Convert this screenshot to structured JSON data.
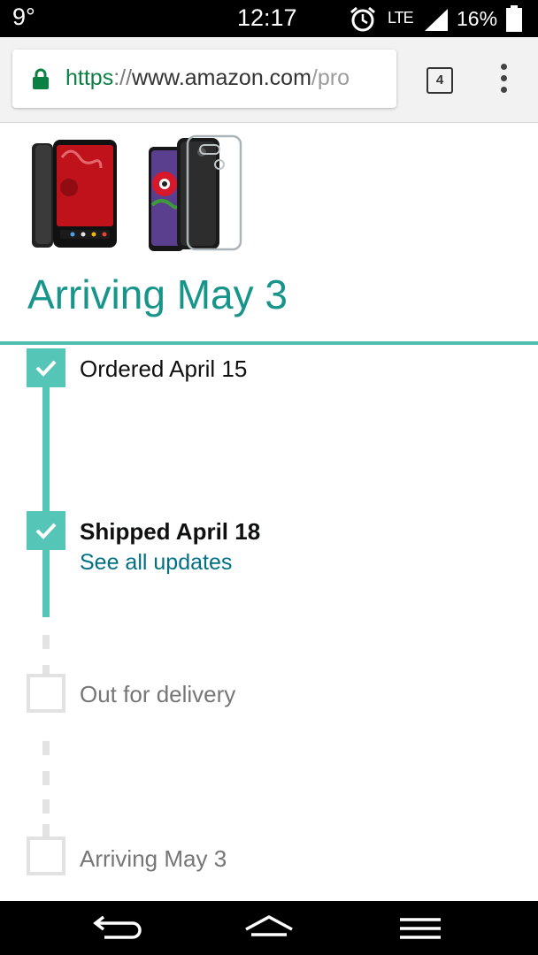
{
  "status_bar": {
    "temperature": "9°",
    "time": "12:17",
    "network": "LTE",
    "battery": "16%"
  },
  "browser": {
    "url_scheme": "https",
    "url_separator": "://",
    "url_host": "www.amazon.com",
    "url_path": "/pro",
    "tab_count": "4"
  },
  "shipment": {
    "heading": "Arriving May 3",
    "steps": [
      {
        "label": "Ordered April 15",
        "done": true
      },
      {
        "label": "Shipped April 18",
        "done": true,
        "link": "See all updates"
      },
      {
        "label": "Out for delivery",
        "done": false
      },
      {
        "label": "Arriving May 3",
        "done": false
      }
    ]
  },
  "colors": {
    "accent": "#17958a",
    "track": "#55c5b7",
    "link": "#007185"
  }
}
